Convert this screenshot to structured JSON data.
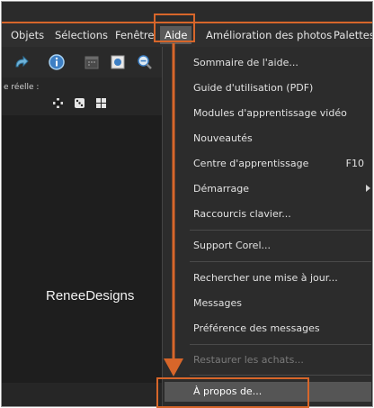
{
  "menubar": {
    "items": [
      "Objets",
      "Sélections",
      "Fenêtre",
      "Aide",
      "Amélioration des photos",
      "Palettes"
    ],
    "active": "Aide"
  },
  "toolbar": {
    "icons": [
      "redo-icon",
      "info-icon",
      "calendar-icon",
      "fit-window-icon",
      "zoom-out-icon"
    ],
    "reelle_label": "e réelle :",
    "small_icons": [
      "move-icon",
      "dice-icon",
      "grid-icon"
    ]
  },
  "watermark": "ReneeDesigns",
  "dropdown": {
    "items": [
      {
        "label": "Sommaire de l'aide...",
        "shortcut": "",
        "submenu": false,
        "disabled": false
      },
      {
        "label": "Guide d'utilisation (PDF)",
        "shortcut": "",
        "submenu": false,
        "disabled": false
      },
      {
        "label": "Modules d'apprentissage vidéo",
        "shortcut": "",
        "submenu": false,
        "disabled": false
      },
      {
        "label": "Nouveautés",
        "shortcut": "",
        "submenu": false,
        "disabled": false
      },
      {
        "label": "Centre d'apprentissage",
        "shortcut": "F10",
        "submenu": false,
        "disabled": false
      },
      {
        "label": "Démarrage",
        "shortcut": "",
        "submenu": true,
        "disabled": false
      },
      {
        "label": "Raccourcis clavier...",
        "shortcut": "",
        "submenu": false,
        "disabled": false
      },
      {
        "label": "Support Corel...",
        "shortcut": "",
        "submenu": false,
        "disabled": false
      },
      {
        "label": "Rechercher une mise à jour...",
        "shortcut": "",
        "submenu": false,
        "disabled": false
      },
      {
        "label": "Messages",
        "shortcut": "",
        "submenu": false,
        "disabled": false
      },
      {
        "label": "Préférence des messages",
        "shortcut": "",
        "submenu": false,
        "disabled": false
      },
      {
        "label": "Restaurer les achats...",
        "shortcut": "",
        "submenu": false,
        "disabled": true
      }
    ],
    "about": "À propos de..."
  },
  "colors": {
    "accent": "#d7662a",
    "menu_bg": "#2c2c2c",
    "highlight": "#555555"
  }
}
